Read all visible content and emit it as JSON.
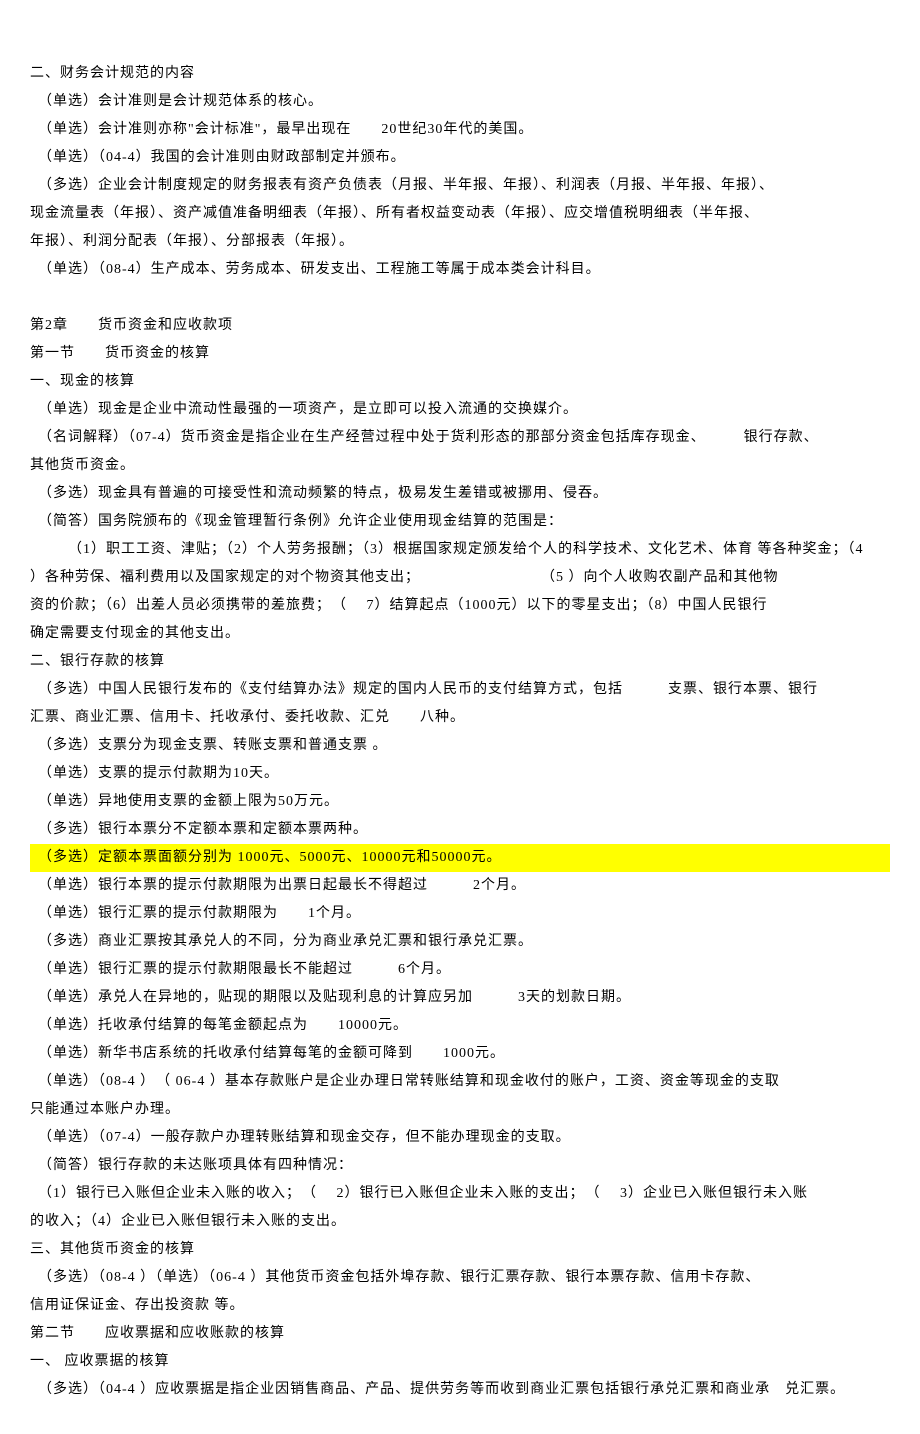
{
  "lines": [
    {
      "text": "二、财务会计规范的内容",
      "highlight": false
    },
    {
      "text": "　（单选）会计准则是会计规范体系的核心。",
      "highlight": false
    },
    {
      "text": "　（单选）会计准则亦称\"会计标准\"，最早出现在　　20世纪30年代的美国。",
      "highlight": false
    },
    {
      "text": "　（单选）（04-4）我国的会计准则由财政部制定并颁布。",
      "highlight": false
    },
    {
      "text": "　（多选）企业会计制度规定的财务报表有资产负债表（月报、半年报、年报）、利润表（月报、半年报、年报）、",
      "highlight": false
    },
    {
      "text": "现金流量表（年报）、资产减值准备明细表（年报）、所有者权益变动表（年报）、应交增值税明细表（半年报、",
      "highlight": false
    },
    {
      "text": "年报）、利润分配表（年报）、分部报表（年报）。",
      "highlight": false
    },
    {
      "text": "　（单选）（08-4）生产成本、劳务成本、研发支出、工程施工等属于成本类会计科目。",
      "highlight": false
    },
    {
      "text": " ",
      "highlight": false
    },
    {
      "text": "第2章　　货币资金和应收款项",
      "highlight": false
    },
    {
      "text": "第一节　　货币资金的核算",
      "highlight": false
    },
    {
      "text": "一、现金的核算",
      "highlight": false
    },
    {
      "text": "　（单选）现金是企业中流动性最强的一项资产，是立即可以投入流通的交换媒介。",
      "highlight": false
    },
    {
      "text": "　（名词解释）（07-4）货币资金是指企业在生产经营过程中处于货利形态的那部分资金包括库存现金、　　　银行存款、",
      "highlight": false
    },
    {
      "text": "其他货币资金。",
      "highlight": false
    },
    {
      "text": "　（多选）现金具有普遍的可接受性和流动频繁的特点，极易发生差错或被挪用、侵吞。",
      "highlight": false
    },
    {
      "text": "　（简答）国务院颁布的《现金管理暂行条例》允许企业使用现金结算的范围是：",
      "highlight": false
    },
    {
      "text": "　　　（1）职工工资、津贴；（2）个人劳务报酬；（3）根据国家规定颁发给个人的科学技术、文化艺术、体育 等各种奖金；（4",
      "highlight": false
    },
    {
      "text": "）各种劳保、福利费用以及国家规定的对个物资其他支出；　　　　　　　　　（5 ）向个人收购农副产品和其他物",
      "highlight": false
    },
    {
      "text": "资的价款；（6）出差人员必须携带的差旅费；　（　 7）结算起点（1000元）以下的零星支出；（8）中国人民银行",
      "highlight": false
    },
    {
      "text": "确定需要支付现金的其他支出。",
      "highlight": false
    },
    {
      "text": "二、银行存款的核算",
      "highlight": false
    },
    {
      "text": "　（多选）中国人民银行发布的《支付结算办法》规定的国内人民币的支付结算方式，包括　　　支票、银行本票、银行",
      "highlight": false
    },
    {
      "text": "汇票、商业汇票、信用卡、托收承付、委托收款、汇兑　　八种。",
      "highlight": false
    },
    {
      "text": "　（多选）支票分为现金支票、转账支票和普通支票 。",
      "highlight": false
    },
    {
      "text": "　（单选）支票的提示付款期为10天。",
      "highlight": false
    },
    {
      "text": "　（单选）异地使用支票的金额上限为50万元。",
      "highlight": false
    },
    {
      "text": "　（多选）银行本票分不定额本票和定额本票两种。",
      "highlight": false
    },
    {
      "text": "　（多选）定额本票面额分别为 1000元、5000元、10000元和50000元。",
      "highlight": true
    },
    {
      "text": "　（单选）银行本票的提示付款期限为出票日起最长不得超过　　　2个月。",
      "highlight": false
    },
    {
      "text": "　（单选）银行汇票的提示付款期限为　　1个月。",
      "highlight": false
    },
    {
      "text": "　（多选）商业汇票按其承兑人的不同，分为商业承兑汇票和银行承兑汇票。",
      "highlight": false
    },
    {
      "text": "　（单选）银行汇票的提示付款期限最长不能超过　　　6个月。",
      "highlight": false
    },
    {
      "text": "　（单选）承兑人在异地的，贴现的期限以及贴现利息的计算应另加　　　3天的划款日期。",
      "highlight": false
    },
    {
      "text": "　（单选）托收承付结算的每笔金额起点为　　10000元。",
      "highlight": false
    },
    {
      "text": "　（单选）新华书店系统的托收承付结算每笔的金额可降到　　1000元。",
      "highlight": false
    },
    {
      "text": "　（单选）（08-4 ）　（ 06-4 ）基本存款账户是企业办理日常转账结算和现金收付的账户，工资、资金等现金的支取",
      "highlight": false
    },
    {
      "text": "只能通过本账户办理。",
      "highlight": false
    },
    {
      "text": "　（单选）（07-4）一般存款户办理转账结算和现金交存，但不能办理现金的支取。",
      "highlight": false
    },
    {
      "text": "　（简答）银行存款的未达账项具体有四种情况：",
      "highlight": false
    },
    {
      "text": "　（1）银行已入账但企业未入账的收入；　（　 2）银行已入账但企业未入账的支出；　（　 3）企业已入账但银行未入账",
      "highlight": false
    },
    {
      "text": "的收入；（4）企业已入账但银行未入账的支出。",
      "highlight": false
    },
    {
      "text": "三、其他货币资金的核算",
      "highlight": false
    },
    {
      "text": "　（多选）（08-4 ）（单选）（06-4 ）其他货币资金包括外埠存款、银行汇票存款、银行本票存款、信用卡存款、",
      "highlight": false
    },
    {
      "text": "信用证保证金、存出投资款 等。",
      "highlight": false
    },
    {
      "text": "第二节　　应收票据和应收账款的核算",
      "highlight": false
    },
    {
      "text": "一、 应收票据的核算",
      "highlight": false
    },
    {
      "text": "　（多选）（04-4 ）应收票据是指企业因销售商品、产品、提供劳务等而收到商业汇票包括银行承兑汇票和商业承　兑汇票。",
      "highlight": false
    }
  ]
}
